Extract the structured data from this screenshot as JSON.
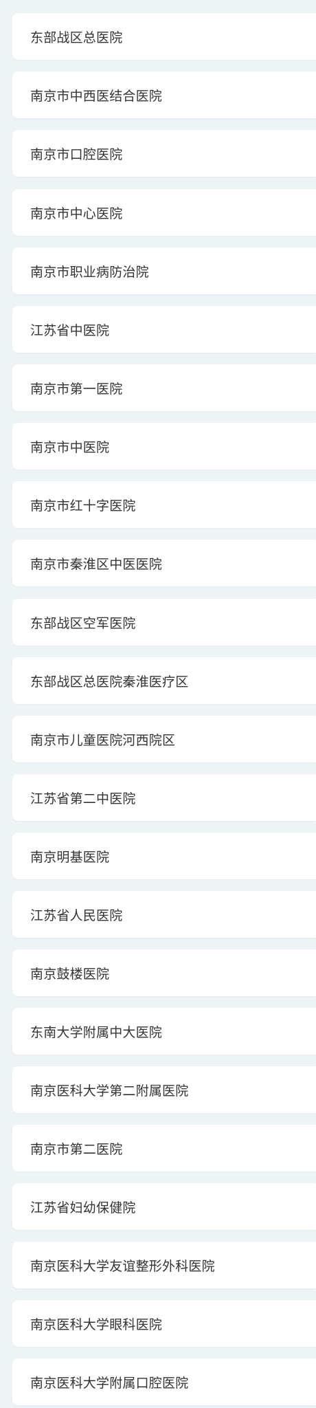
{
  "hospitals": [
    {
      "label": "东部战区总医院"
    },
    {
      "label": "南京市中西医结合医院"
    },
    {
      "label": "南京市口腔医院"
    },
    {
      "label": "南京市中心医院"
    },
    {
      "label": "南京市职业病防治院"
    },
    {
      "label": "江苏省中医院"
    },
    {
      "label": "南京市第一医院"
    },
    {
      "label": "南京市中医院"
    },
    {
      "label": "南京市红十字医院"
    },
    {
      "label": "南京市秦淮区中医医院"
    },
    {
      "label": "东部战区空军医院"
    },
    {
      "label": "东部战区总医院秦淮医疗区"
    },
    {
      "label": "南京市儿童医院河西院区"
    },
    {
      "label": "江苏省第二中医院"
    },
    {
      "label": "南京明基医院"
    },
    {
      "label": "江苏省人民医院"
    },
    {
      "label": "南京鼓楼医院"
    },
    {
      "label": "东南大学附属中大医院"
    },
    {
      "label": "南京医科大学第二附属医院"
    },
    {
      "label": "南京市第二医院"
    },
    {
      "label": "江苏省妇幼保健院"
    },
    {
      "label": "南京医科大学友谊整形外科医院"
    },
    {
      "label": "南京医科大学眼科医院"
    },
    {
      "label": "南京医科大学附属口腔医院"
    }
  ]
}
